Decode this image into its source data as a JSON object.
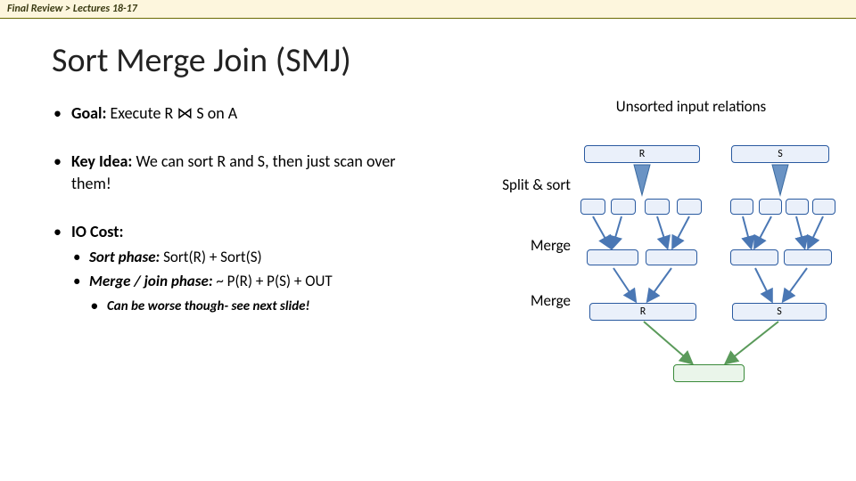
{
  "breadcrumb": "Final Review  >  Lectures 18-17",
  "title": "Sort Merge Join (SMJ)",
  "bullets": {
    "goal_label": "Goal:",
    "goal_text": " Execute R ⋈ S on A",
    "key_label": "Key Idea:",
    "key_text": " We can sort R and S, then just scan over them!",
    "io_label": "IO Cost:",
    "io_sub1_label": "Sort phase:",
    "io_sub1_text": " Sort(R) + Sort(S)",
    "io_sub2_label": "Merge / join phase:",
    "io_sub2_text": " ~ P(R) + P(S) + OUT",
    "io_sub2_note": "Can be worse though- see next slide!"
  },
  "diagram": {
    "top_caption": "Unsorted input relations",
    "R": "R",
    "S": "S",
    "split_label": "Split & sort",
    "merge_label": "Merge"
  }
}
